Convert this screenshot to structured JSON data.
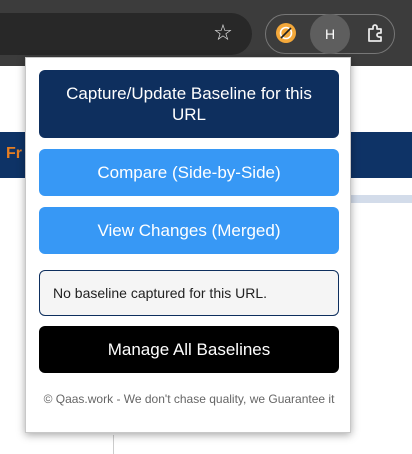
{
  "browser": {
    "avatar_initial": "H",
    "icons": [
      "star-icon",
      "extension-icon",
      "profile-avatar",
      "puzzle-icon"
    ]
  },
  "page": {
    "band_text": "Fr"
  },
  "popup": {
    "capture_button": "Capture/Update Baseline for this URL",
    "compare_button": "Compare (Side-by-Side)",
    "view_changes_button": "View Changes (Merged)",
    "status_text": "No baseline captured for this URL.",
    "manage_button": "Manage All Baselines",
    "footer_text": "© Qaas.work - We don't chase quality, we Guarantee it"
  },
  "colors": {
    "primary_dark": "#0e2f5e",
    "primary_blue": "#3798f5",
    "manage_black": "#000000",
    "accent_orange": "#e67e22"
  }
}
